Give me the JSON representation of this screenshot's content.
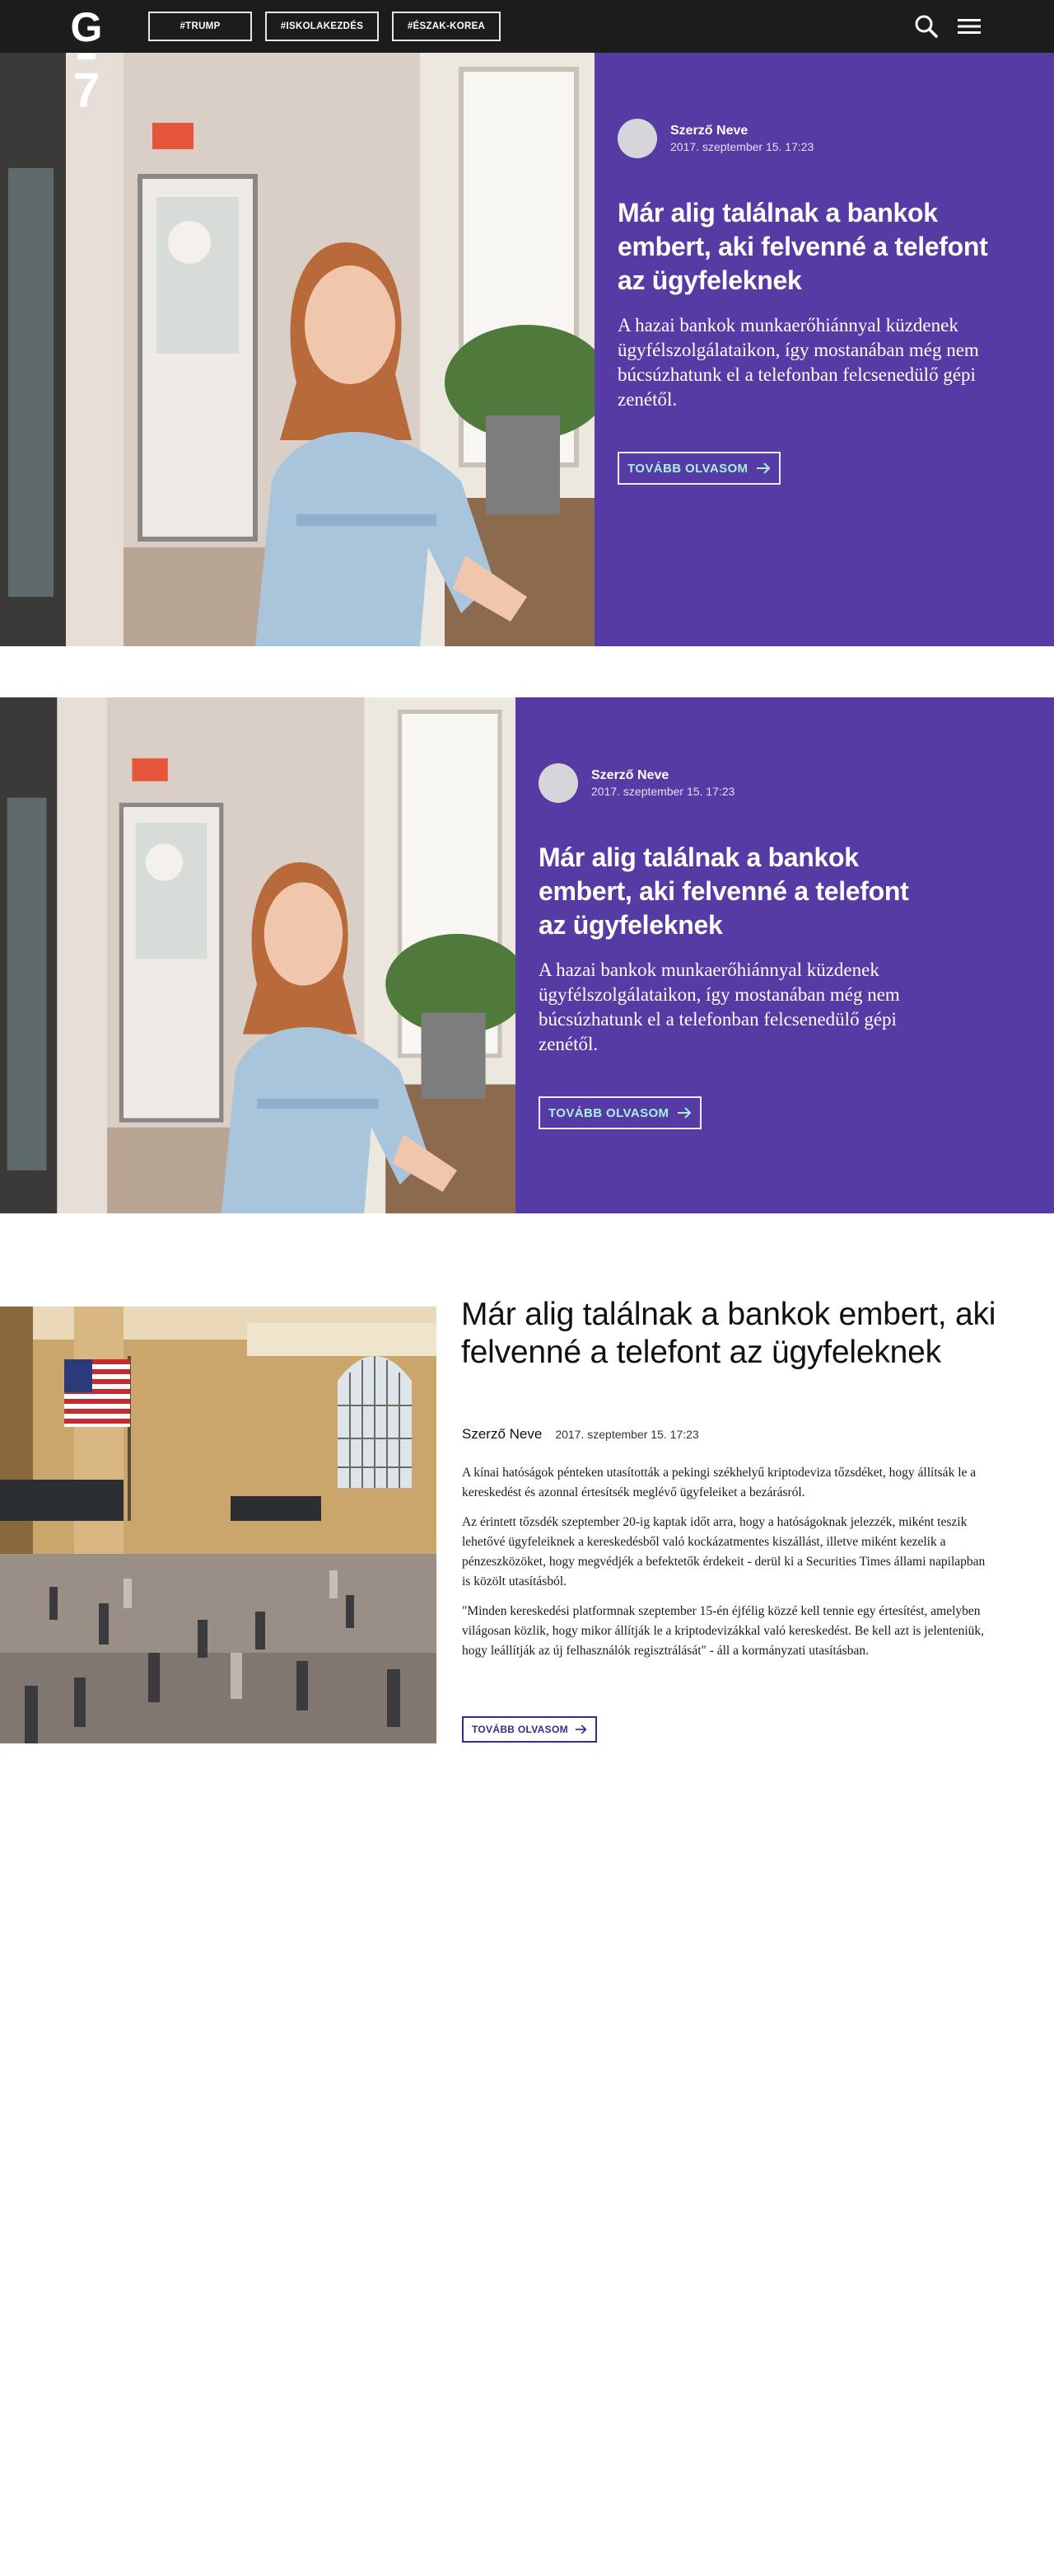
{
  "header": {
    "logo_letter": "G",
    "logo_number": "7",
    "tags": [
      "#TRUMP",
      "#ISKOLAKEZDÉS",
      "#ÉSZAK-KOREA"
    ]
  },
  "hero1": {
    "author": "Szerző Neve",
    "date": "2017. szeptember 15. 17:23",
    "title": "Már alig találnak a bankok embert, aki felvenné a telefont az ügyfeleknek",
    "lead": "A hazai bankok munkaerőhiánnyal küzdenek ügyfélszolgálataikon, így mostanában még nem búcsúzhatunk el a telefonban felcsenedülő gépi zenétől.",
    "button": "TOVÁBB OLVASOM"
  },
  "hero2": {
    "author": "Szerző Neve",
    "date": "2017. szeptember 15. 17:23",
    "title": "Már alig találnak a bankok embert, aki felvenné a telefont az ügyfeleknek",
    "lead": "A hazai bankok munkaerőhiánnyal küzdenek ügyfélszolgálataikon, így mostanában még nem búcsúzhatunk el a telefonban felcsenedülő gépi zenétől.",
    "button": "TOVÁBB OLVASOM"
  },
  "article": {
    "title": "Már alig találnak a bankok embert, aki felvenné a telefont az ügyfeleknek",
    "author": "Szerző Neve",
    "date": "2017. szeptember 15. 17:23",
    "paragraphs": [
      "A kínai hatóságok pénteken utasították a pekingi székhelyű kriptodeviza tőzsdéket, hogy állítsák le a kereskedést és azonnal értesítsék meglévő ügyfeleiket a bezárásról.",
      "Az érintett tőzsdék szeptember 20-ig kaptak időt arra, hogy a hatóságoknak jelezzék, miként teszik lehetővé ügyfeleiknek a kereskedésből való kockázatmentes kiszállást, illetve miként kezelik a pénzeszközöket, hogy megvédjék a befektetők érdekeit - derül ki a Securities Times állami napilapban is közölt utasításból.",
      "\"Minden kereskedési platformnak szeptember 15-én éjfélig közzé kell tennie egy értesítést, amelyben világosan közlik, hogy mikor állítják le a kriptodevizákkal való kereskedést. Be kell azt is jelenteniük, hogy leállítják az új felhasználók regisztrálását\" - áll a kormányzati utasításban."
    ],
    "button": "TOVÁBB OLVASOM"
  },
  "colors": {
    "header_bg": "#1c1c1c",
    "panel_purple": "#553ba3",
    "button_text_mint": "#a6f0e4",
    "article_button": "#3c2a8a"
  },
  "icons": [
    "search-icon",
    "menu-icon",
    "arrow-right-icon"
  ]
}
